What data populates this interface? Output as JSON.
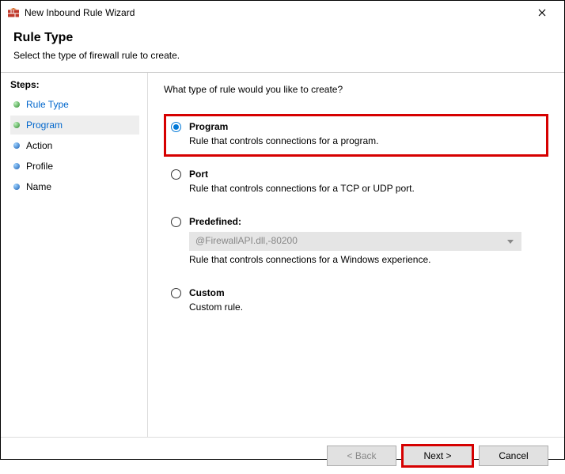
{
  "window": {
    "title": "New Inbound Rule Wizard"
  },
  "header": {
    "heading": "Rule Type",
    "subheading": "Select the type of firewall rule to create."
  },
  "sidebar": {
    "label": "Steps:",
    "items": [
      {
        "label": "Rule Type",
        "state": "done"
      },
      {
        "label": "Program",
        "state": "current"
      },
      {
        "label": "Action",
        "state": "pending"
      },
      {
        "label": "Profile",
        "state": "pending"
      },
      {
        "label": "Name",
        "state": "pending"
      }
    ]
  },
  "content": {
    "prompt": "What type of rule would you like to create?",
    "options": [
      {
        "title": "Program",
        "desc": "Rule that controls connections for a program.",
        "checked": true,
        "highlight": true
      },
      {
        "title": "Port",
        "desc": "Rule that controls connections for a TCP or UDP port.",
        "checked": false
      },
      {
        "title": "Predefined:",
        "desc": "Rule that controls connections for a Windows experience.",
        "checked": false,
        "select_value": "@FirewallAPI.dll,-80200"
      },
      {
        "title": "Custom",
        "desc": "Custom rule.",
        "checked": false
      }
    ]
  },
  "footer": {
    "back": "< Back",
    "next": "Next >",
    "cancel": "Cancel"
  }
}
